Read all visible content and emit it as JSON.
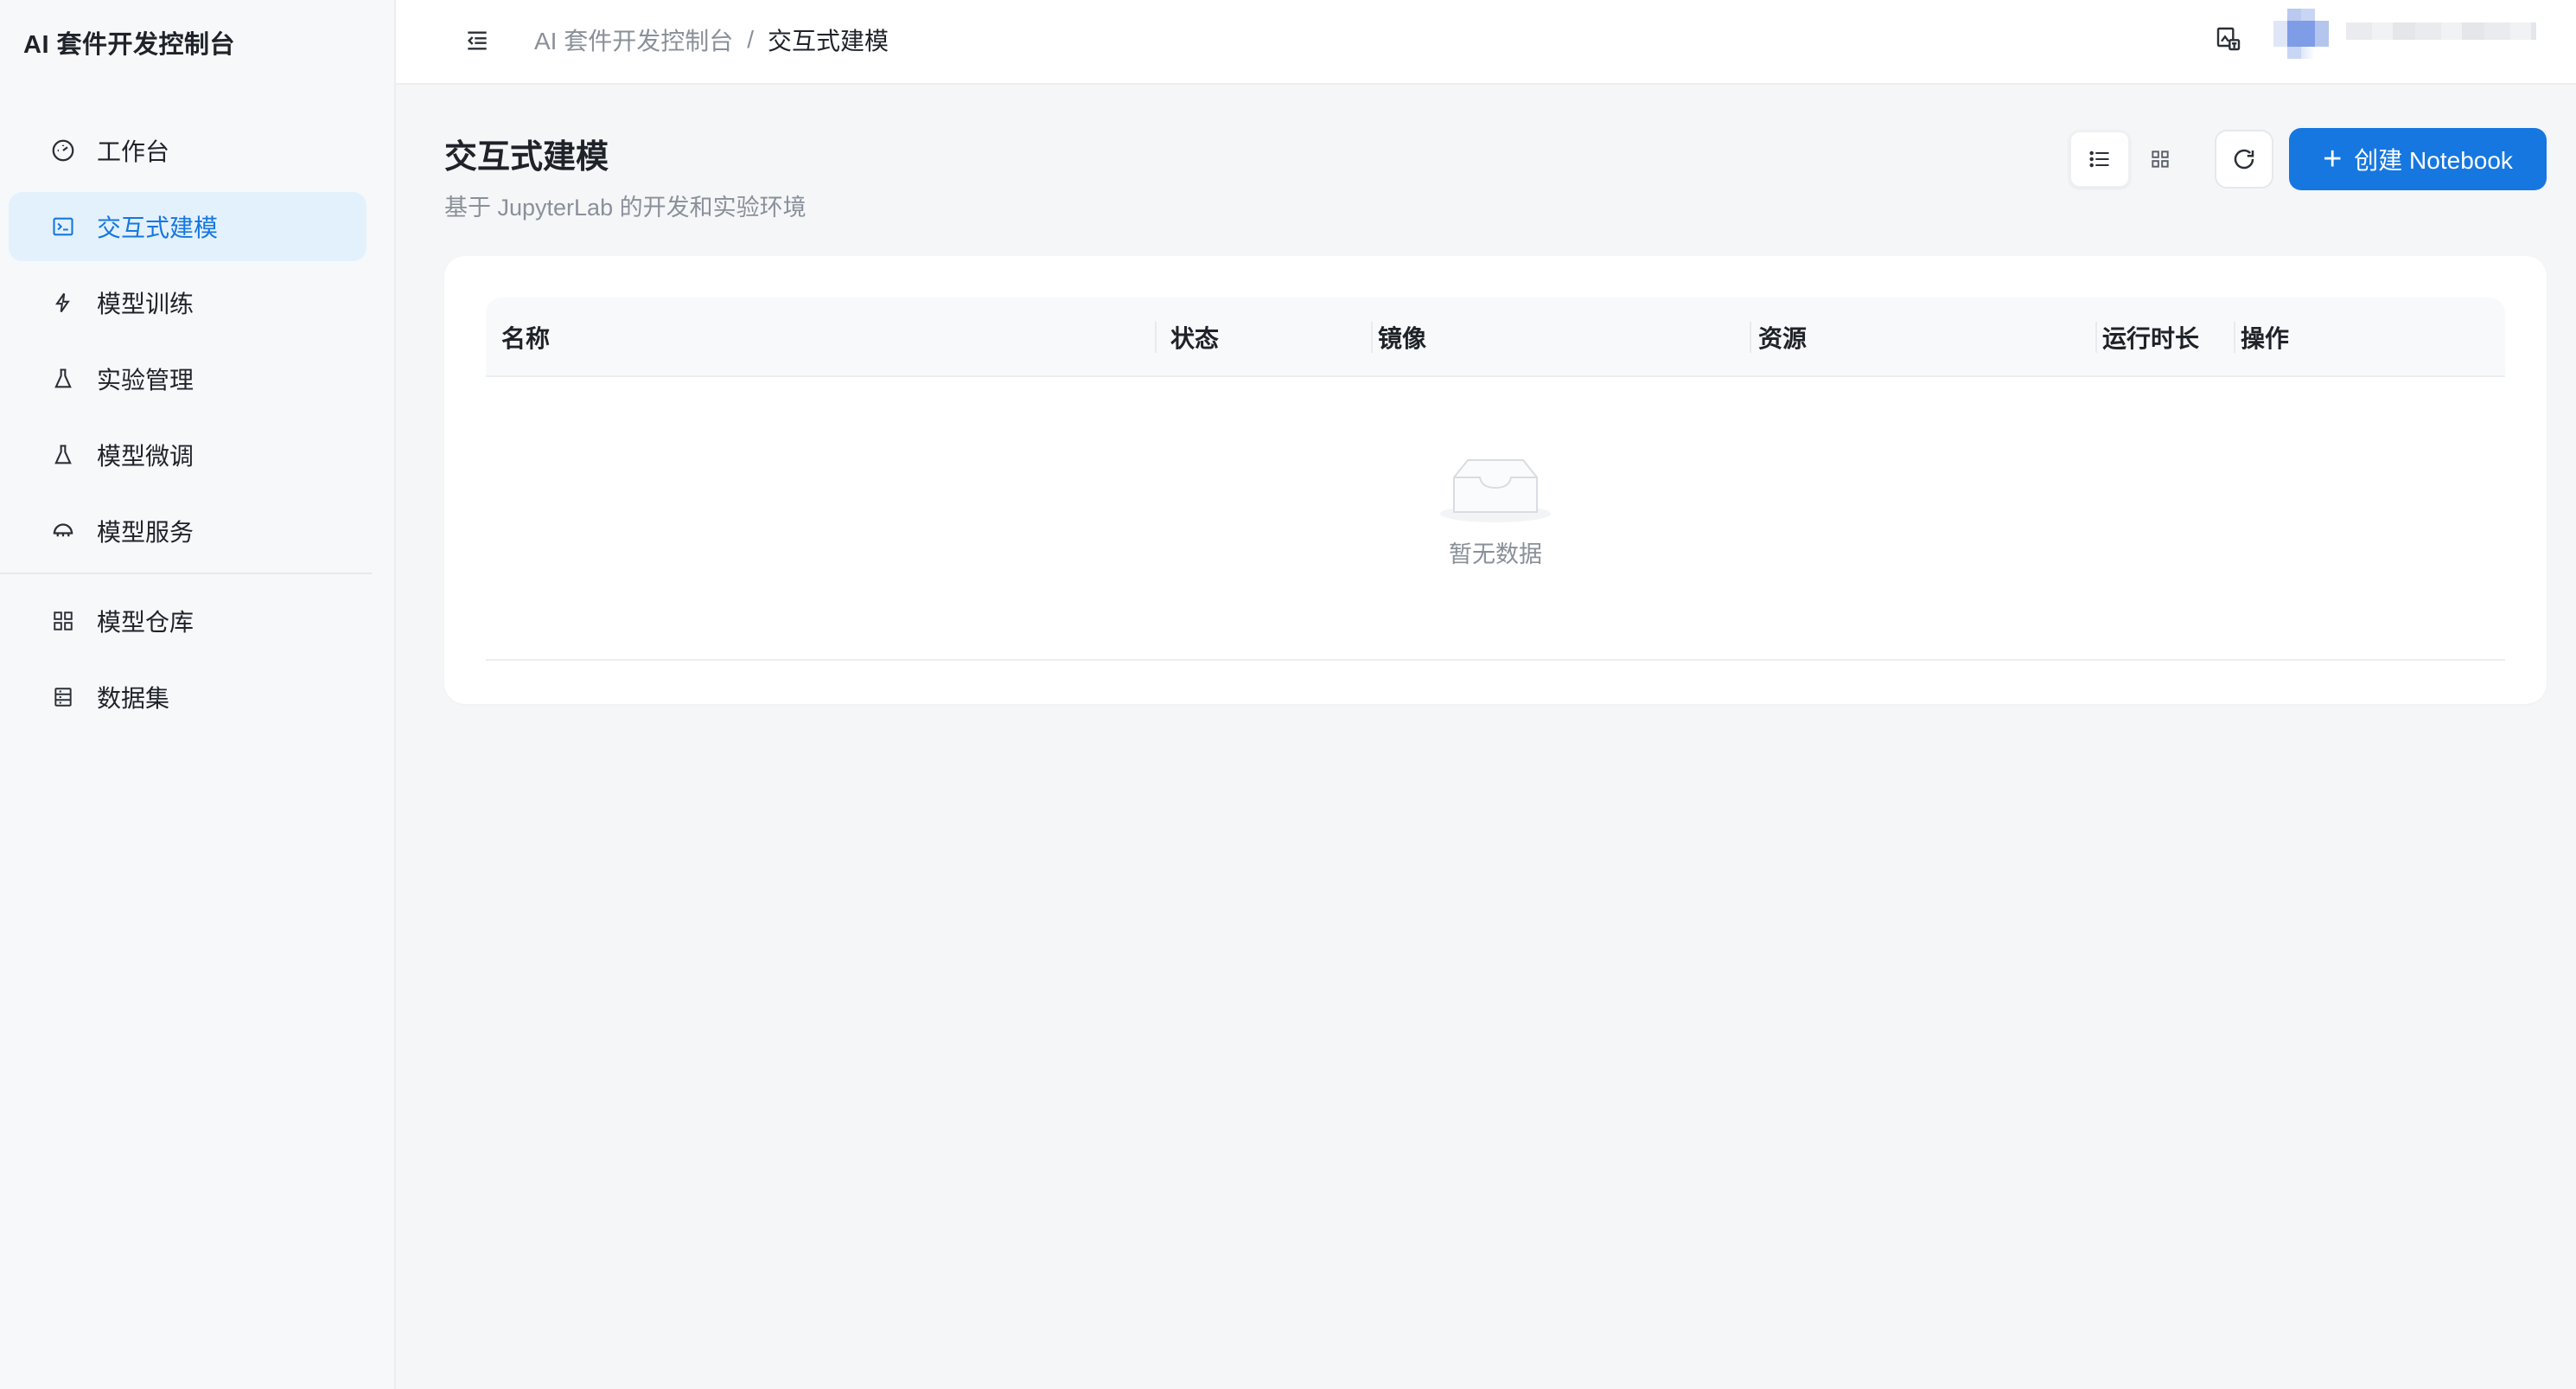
{
  "app": {
    "brand": "AI 套件开发控制台"
  },
  "sidebar": {
    "items": [
      {
        "label": "工作台",
        "icon": "dashboard-icon",
        "active": false
      },
      {
        "label": "交互式建模",
        "icon": "terminal-icon",
        "active": true
      },
      {
        "label": "模型训练",
        "icon": "lightning-icon",
        "active": false
      },
      {
        "label": "实验管理",
        "icon": "flask-icon",
        "active": false
      },
      {
        "label": "模型微调",
        "icon": "flask-icon",
        "active": false
      },
      {
        "label": "模型服务",
        "icon": "cloud-icon",
        "active": false
      }
    ],
    "items2": [
      {
        "label": "模型仓库",
        "icon": "grid-icon",
        "active": false
      },
      {
        "label": "数据集",
        "icon": "database-icon",
        "active": false
      }
    ]
  },
  "header": {
    "breadcrumb": [
      "AI 套件开发控制台",
      "交互式建模"
    ],
    "separator": "/"
  },
  "page": {
    "title": "交互式建模",
    "subtitle": "基于 JupyterLab 的开发和实验环境"
  },
  "toolbar": {
    "list_view": "list-view-icon",
    "grid_view": "grid-view-icon",
    "refresh": "refresh-icon",
    "create_label": "创建 Notebook",
    "create_plus": "+"
  },
  "table": {
    "columns": [
      "名称",
      "状态",
      "镜像",
      "资源",
      "运行时长",
      "操作"
    ],
    "rows": [],
    "empty_text": "暂无数据"
  },
  "colors": {
    "accent": "#1677e0",
    "active_bg": "#e3f1fd"
  }
}
